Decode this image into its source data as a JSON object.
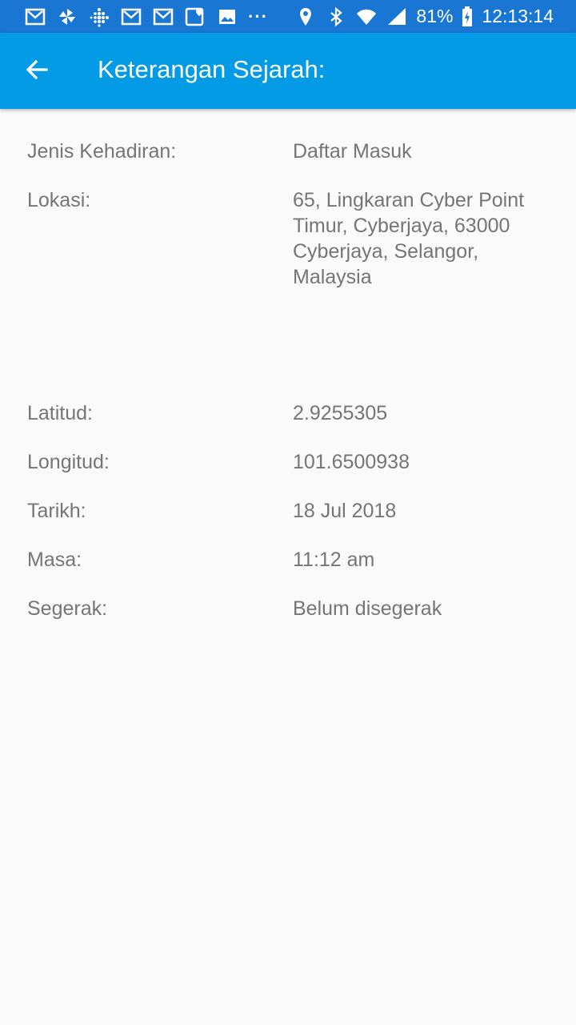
{
  "status_bar": {
    "battery": "81%",
    "time": "12:13:14",
    "more": "···"
  },
  "app_bar": {
    "title": "Keterangan Sejarah:"
  },
  "details": {
    "jenis_label": "Jenis Kehadiran:",
    "jenis_value": "Daftar Masuk",
    "lokasi_label": "Lokasi:",
    "lokasi_value": "65, Lingkaran Cyber Point Timur, Cyberjaya, 63000 Cyberjaya, Selangor, Malaysia",
    "latitud_label": "Latitud:",
    "latitud_value": "2.9255305",
    "longitud_label": "Longitud:",
    "longitud_value": "101.6500938",
    "tarikh_label": "Tarikh:",
    "tarikh_value": "18 Jul 2018",
    "masa_label": "Masa:",
    "masa_value": "11:12 am",
    "segerak_label": "Segerak:",
    "segerak_value": "Belum disegerak"
  }
}
